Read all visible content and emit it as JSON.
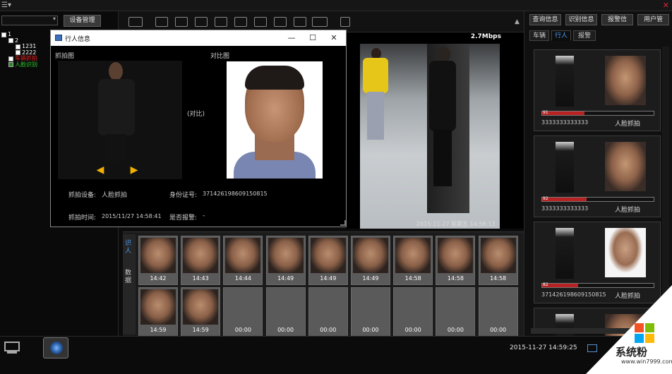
{
  "window": {
    "menu_glyph": "☰▾",
    "close_glyph": "✕"
  },
  "left": {
    "device_button": "设备管理",
    "tree": [
      {
        "label": "1",
        "indent": 0,
        "color": "#ffffff",
        "checked": false
      },
      {
        "label": "2",
        "indent": 1,
        "color": "#ffffff",
        "checked": false
      },
      {
        "label": "1231",
        "indent": 2,
        "color": "#ffffff",
        "checked": false
      },
      {
        "label": "2222",
        "indent": 2,
        "color": "#ffffff",
        "checked": false
      },
      {
        "label": "车辆抓拍",
        "indent": 1,
        "color": "#e52020",
        "checked": false
      },
      {
        "label": "人脸识别",
        "indent": 1,
        "color": "#2fd22f",
        "checked": true
      }
    ]
  },
  "video": {
    "bitrate": "2.7Mbps",
    "timestamp": "2015-11-27 星期五 14:58:13"
  },
  "toolbar": {
    "up_glyph": "▲"
  },
  "right": {
    "buttons": [
      "查询信息",
      "识别信息",
      "报警信",
      "用户管"
    ],
    "tabs": [
      "车辆",
      "行人",
      "报警"
    ],
    "active_tab": 1,
    "cards": [
      {
        "num": "91",
        "score": 0.38,
        "id": "3333333333333",
        "type": "人脸抓拍"
      },
      {
        "num": "92",
        "score": 0.4,
        "id": "3333333333333",
        "type": "人脸抓拍"
      },
      {
        "num": "82",
        "score": 0.32,
        "id": "371426198609150815",
        "type": "人脸抓拍"
      },
      {
        "num": "",
        "score": 0,
        "id": "",
        "type": ""
      }
    ]
  },
  "thumbs": {
    "side_tabs": [
      "识人",
      "数据"
    ],
    "items": [
      "14:42",
      "14:43",
      "14:44",
      "14:49",
      "14:49",
      "14:49",
      "14:58",
      "14:58",
      "14:58",
      "14:59",
      "14:59",
      "00:00",
      "00:00",
      "00:00",
      "00:00",
      "00:00",
      "00:00",
      "00:00"
    ]
  },
  "popup": {
    "title": "行人信息",
    "snap_label": "抓拍图",
    "compare_label": "对比图",
    "compare_text": "(对比)",
    "device_label": "抓拍设备:",
    "device_value": "人脸抓拍",
    "idnum_label": "身份证号:",
    "idnum_value": "371426198609150815",
    "time_label": "抓拍时间:",
    "time_value": "2015/11/27 14:58:41",
    "alarm_label": "是否报警:",
    "alarm_value": "-",
    "left_arrow": "◀",
    "right_arrow": "▶",
    "minimize": "—",
    "maximize": "☐",
    "close": "✕"
  },
  "bottom": {
    "clock": "2015-11-27 14:59:25"
  },
  "watermark": {
    "text": "系统粉",
    "url": "www.win7999.com"
  }
}
